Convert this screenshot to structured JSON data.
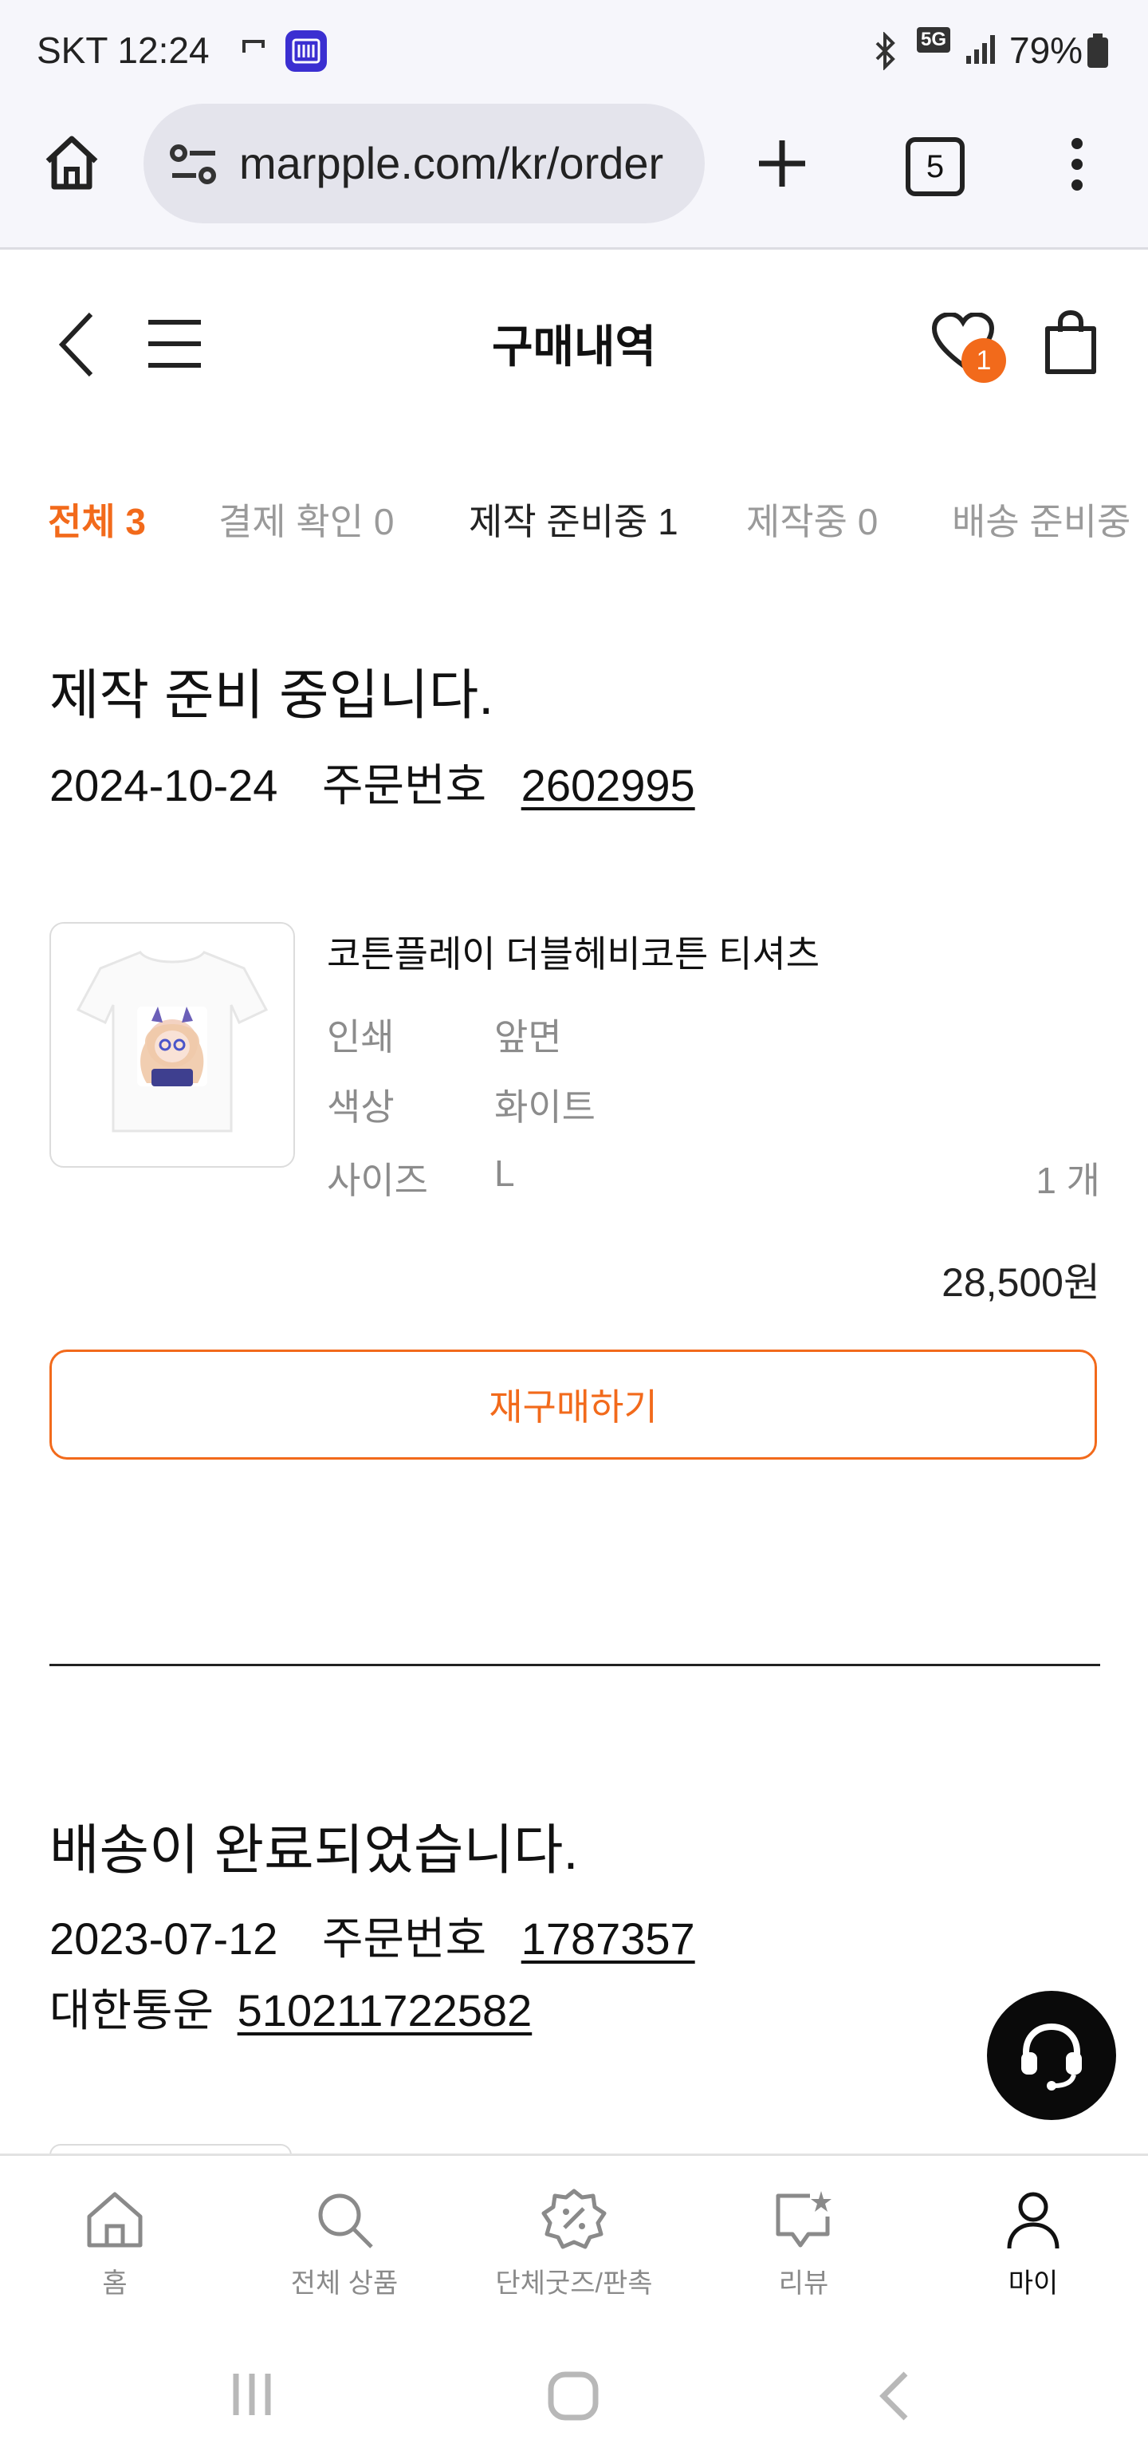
{
  "status_bar": {
    "carrier_time": "SKT 12:24",
    "network": "5G",
    "battery": "79%"
  },
  "browser": {
    "url": "marpple.com/kr/order",
    "tab_count": "5"
  },
  "header": {
    "title": "구매내역",
    "wishlist_badge": "1"
  },
  "tabs": [
    {
      "label": "전체 3"
    },
    {
      "label": "결제 확인 0"
    },
    {
      "label": "제작 준비중 1"
    },
    {
      "label": "제작중 0"
    },
    {
      "label": "배송 준비중"
    }
  ],
  "orders": [
    {
      "status": "제작 준비 중입니다.",
      "date": "2024-10-24",
      "order_no_label": "주문번호",
      "order_no": "2602995",
      "product": {
        "name": "코튼플레이 더블헤비코튼 티셔츠",
        "options": [
          {
            "label": "인쇄",
            "value": "앞면"
          },
          {
            "label": "색상",
            "value": "화이트"
          },
          {
            "label": "사이즈",
            "value": "L"
          }
        ],
        "quantity": "1 개",
        "price": "28,500원"
      },
      "rebuy_label": "재구매하기"
    },
    {
      "status": "배송이 완료되었습니다.",
      "date": "2023-07-12",
      "order_no_label": "주문번호",
      "order_no": "1787357",
      "courier": "대한통운",
      "tracking_no": "510211722582"
    }
  ],
  "bottom_nav": [
    {
      "label": "홈",
      "icon": "home-icon"
    },
    {
      "label": "전체 상품",
      "icon": "search-icon"
    },
    {
      "label": "단체굿즈/판촉",
      "icon": "discount-badge-icon"
    },
    {
      "label": "리뷰",
      "icon": "review-icon"
    },
    {
      "label": "마이",
      "icon": "user-icon"
    }
  ],
  "colors": {
    "accent": "#f26a1b",
    "text": "#111111",
    "muted": "#8c8c8c"
  }
}
